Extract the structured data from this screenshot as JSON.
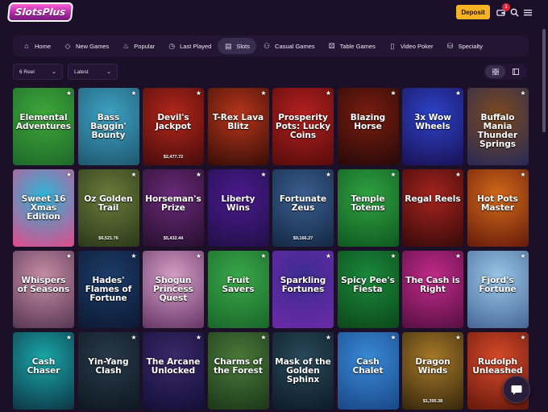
{
  "header": {
    "logo_text": "SlotsPlus",
    "deposit_label": "Deposit",
    "notification_count": "1"
  },
  "nav": {
    "items": [
      {
        "label": "Home",
        "icon": "home-icon"
      },
      {
        "label": "New Games",
        "icon": "diamond-icon"
      },
      {
        "label": "Popular",
        "icon": "flame-icon"
      },
      {
        "label": "Last Played",
        "icon": "history-icon"
      },
      {
        "label": "Slots",
        "icon": "slots-icon"
      },
      {
        "label": "Casual Games",
        "icon": "gamepad-icon"
      },
      {
        "label": "Table Games",
        "icon": "dice-icon"
      },
      {
        "label": "Video Poker",
        "icon": "cards-icon"
      },
      {
        "label": "Specialty",
        "icon": "specialty-icon"
      }
    ],
    "active": "Slots"
  },
  "filters": {
    "reel_value": "6 Reel",
    "sort_value": "Latest"
  },
  "games": [
    {
      "title": "Elemental Adventures",
      "jackpot": "",
      "bg": [
        "#3fa83a",
        "#1f6b2a"
      ]
    },
    {
      "title": "Bass Baggin' Bounty",
      "jackpot": "",
      "bg": [
        "#3fa3c4",
        "#1f5a72"
      ]
    },
    {
      "title": "Devil's Jackpot",
      "jackpot": "$2,477.72",
      "bg": [
        "#b4271a",
        "#4a0c0c"
      ]
    },
    {
      "title": "T-Rex Lava Blitz",
      "jackpot": "",
      "bg": [
        "#b8361b",
        "#3c0f08"
      ]
    },
    {
      "title": "Prosperity Pots: Lucky Coins",
      "jackpot": "",
      "bg": [
        "#b62020",
        "#5a0c0c"
      ]
    },
    {
      "title": "Blazing Horse",
      "jackpot": "",
      "bg": [
        "#7a1d0e",
        "#2a0a0a"
      ]
    },
    {
      "title": "3x Wow Wheels",
      "jackpot": "",
      "bg": [
        "#2c43c9",
        "#1b135a"
      ]
    },
    {
      "title": "Buffalo Mania Thunder Springs",
      "jackpot": "",
      "bg": [
        "#7d4a1e",
        "#2b2b55"
      ]
    },
    {
      "title": "Sweet 16 Xmas Edition",
      "jackpot": "",
      "bg": [
        "#2bb5d8",
        "#d94f8e"
      ]
    },
    {
      "title": "Oz Golden Trail",
      "jackpot": "$6,521.76",
      "bg": [
        "#6a7c3a",
        "#2d3b1b"
      ]
    },
    {
      "title": "Horseman's Prize",
      "jackpot": "$5,432.44",
      "bg": [
        "#6a2a7a",
        "#2a1030"
      ]
    },
    {
      "title": "Liberty Wins",
      "jackpot": "",
      "bg": [
        "#4b1a8f",
        "#22104a"
      ]
    },
    {
      "title": "Fortunate Zeus",
      "jackpot": "$9,166.27",
      "bg": [
        "#3a5f8f",
        "#152a48"
      ]
    },
    {
      "title": "Temple Totems",
      "jackpot": "",
      "bg": [
        "#2fa341",
        "#115b22"
      ]
    },
    {
      "title": "Regal Reels",
      "jackpot": "",
      "bg": [
        "#a6231d",
        "#3b0b0b"
      ]
    },
    {
      "title": "Hot Pots Master",
      "jackpot": "",
      "bg": [
        "#d26a1a",
        "#6b1e0c"
      ]
    },
    {
      "title": "Whispers of Seasons",
      "jackpot": "",
      "bg": [
        "#c98ea8",
        "#5b3a55"
      ]
    },
    {
      "title": "Hades' Flames of Fortune",
      "jackpot": "",
      "bg": [
        "#1c3d6b",
        "#0d1a33"
      ]
    },
    {
      "title": "Shogun Princess Quest",
      "jackpot": "",
      "bg": [
        "#d8a0c8",
        "#6a3a6a"
      ]
    },
    {
      "title": "Fruit Savers",
      "jackpot": "",
      "bg": [
        "#3aa84a",
        "#1a6a2a"
      ]
    },
    {
      "title": "Sparkling Fortunes",
      "jackpot": "",
      "bg": [
        "#3a2b8f",
        "#6a2aa8"
      ]
    },
    {
      "title": "Spicy Pee's Fiesta",
      "jackpot": "",
      "bg": [
        "#1a8a3a",
        "#0d4a1d"
      ]
    },
    {
      "title": "The Cash is Right",
      "jackpot": "",
      "bg": [
        "#c42a8a",
        "#5a1045"
      ]
    },
    {
      "title": "Fjord's Fortune",
      "jackpot": "",
      "bg": [
        "#9ac8e8",
        "#4a6a9a"
      ]
    },
    {
      "title": "Cash Chaser",
      "jackpot": "",
      "bg": [
        "#1aa8a8",
        "#0d3a4a"
      ]
    },
    {
      "title": "Yin-Yang Clash",
      "jackpot": "",
      "bg": [
        "#2a3a4a",
        "#0d1a22"
      ]
    },
    {
      "title": "The Arcane Unlocked",
      "jackpot": "",
      "bg": [
        "#3a2a6a",
        "#15103a"
      ]
    },
    {
      "title": "Charms of the Forest",
      "jackpot": "",
      "bg": [
        "#4a7a3a",
        "#1d3a1a"
      ]
    },
    {
      "title": "Mask of the Golden Sphinx",
      "jackpot": "",
      "bg": [
        "#2a4a5a",
        "#0d1d2a"
      ]
    },
    {
      "title": "Cash Chalet",
      "jackpot": "",
      "bg": [
        "#3a8ad8",
        "#1a4a8a"
      ]
    },
    {
      "title": "Dragon Winds",
      "jackpot": "$1,395.38",
      "bg": [
        "#a87a2a",
        "#3a2a0d"
      ]
    },
    {
      "title": "Rudolph Unleashed",
      "jackpot": "",
      "bg": [
        "#d84a2a",
        "#6a1a0d"
      ]
    }
  ]
}
